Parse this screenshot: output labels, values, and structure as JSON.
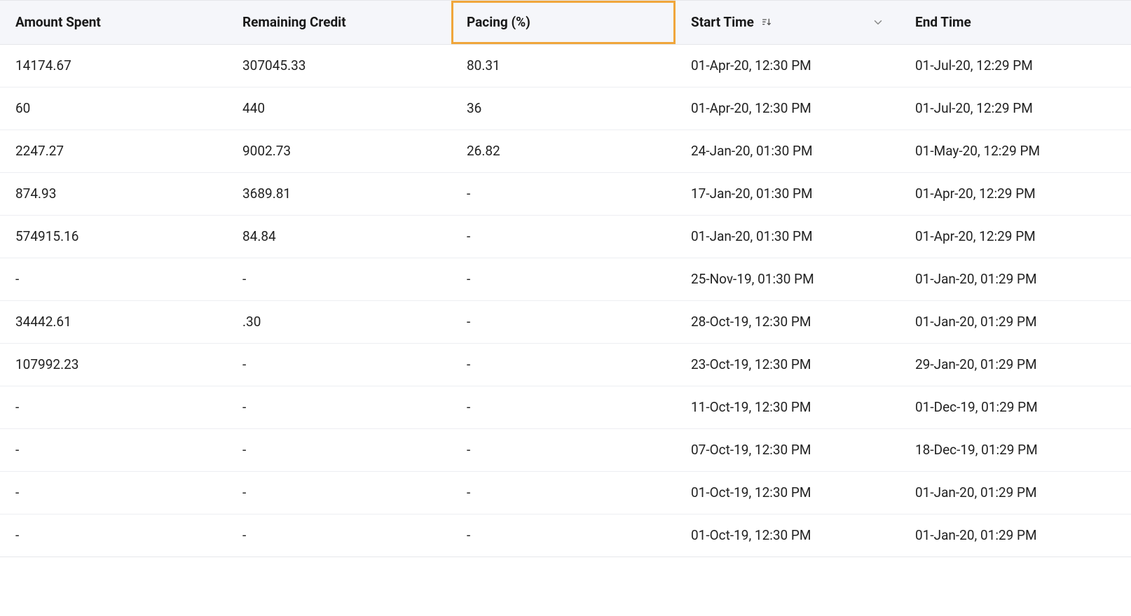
{
  "table": {
    "headers": {
      "amountSpent": "Amount Spent",
      "remainingCredit": "Remaining Credit",
      "pacing": "Pacing (%)",
      "startTime": "Start Time",
      "endTime": "End Time"
    },
    "highlightedColumn": "pacing",
    "sortedColumn": "startTime",
    "rows": [
      {
        "amountSpent": "14174.67",
        "remainingCredit": "307045.33",
        "pacing": "80.31",
        "startTime": "01-Apr-20, 12:30 PM",
        "endTime": "01-Jul-20, 12:29 PM"
      },
      {
        "amountSpent": "60",
        "remainingCredit": "440",
        "pacing": "36",
        "startTime": "01-Apr-20, 12:30 PM",
        "endTime": "01-Jul-20, 12:29 PM"
      },
      {
        "amountSpent": "2247.27",
        "remainingCredit": "9002.73",
        "pacing": "26.82",
        "startTime": "24-Jan-20, 01:30 PM",
        "endTime": "01-May-20, 12:29 PM"
      },
      {
        "amountSpent": "874.93",
        "remainingCredit": "3689.81",
        "pacing": "-",
        "startTime": "17-Jan-20, 01:30 PM",
        "endTime": "01-Apr-20, 12:29 PM"
      },
      {
        "amountSpent": "574915.16",
        "remainingCredit": "84.84",
        "pacing": "-",
        "startTime": "01-Jan-20, 01:30 PM",
        "endTime": "01-Apr-20, 12:29 PM"
      },
      {
        "amountSpent": "-",
        "remainingCredit": "-",
        "pacing": "-",
        "startTime": "25-Nov-19, 01:30 PM",
        "endTime": "01-Jan-20, 01:29 PM"
      },
      {
        "amountSpent": "34442.61",
        "remainingCredit": ".30",
        "pacing": "-",
        "startTime": "28-Oct-19, 12:30 PM",
        "endTime": "01-Jan-20, 01:29 PM"
      },
      {
        "amountSpent": "107992.23",
        "remainingCredit": "-",
        "pacing": "-",
        "startTime": "23-Oct-19, 12:30 PM",
        "endTime": "29-Jan-20, 01:29 PM"
      },
      {
        "amountSpent": "-",
        "remainingCredit": "-",
        "pacing": "-",
        "startTime": "11-Oct-19, 12:30 PM",
        "endTime": "01-Dec-19, 01:29 PM"
      },
      {
        "amountSpent": "-",
        "remainingCredit": "-",
        "pacing": "-",
        "startTime": "07-Oct-19, 12:30 PM",
        "endTime": "18-Dec-19, 01:29 PM"
      },
      {
        "amountSpent": "-",
        "remainingCredit": "-",
        "pacing": "-",
        "startTime": "01-Oct-19, 12:30 PM",
        "endTime": "01-Jan-20, 01:29 PM"
      },
      {
        "amountSpent": "-",
        "remainingCredit": "-",
        "pacing": "-",
        "startTime": "01-Oct-19, 12:30 PM",
        "endTime": "01-Jan-20, 01:29 PM"
      }
    ]
  }
}
